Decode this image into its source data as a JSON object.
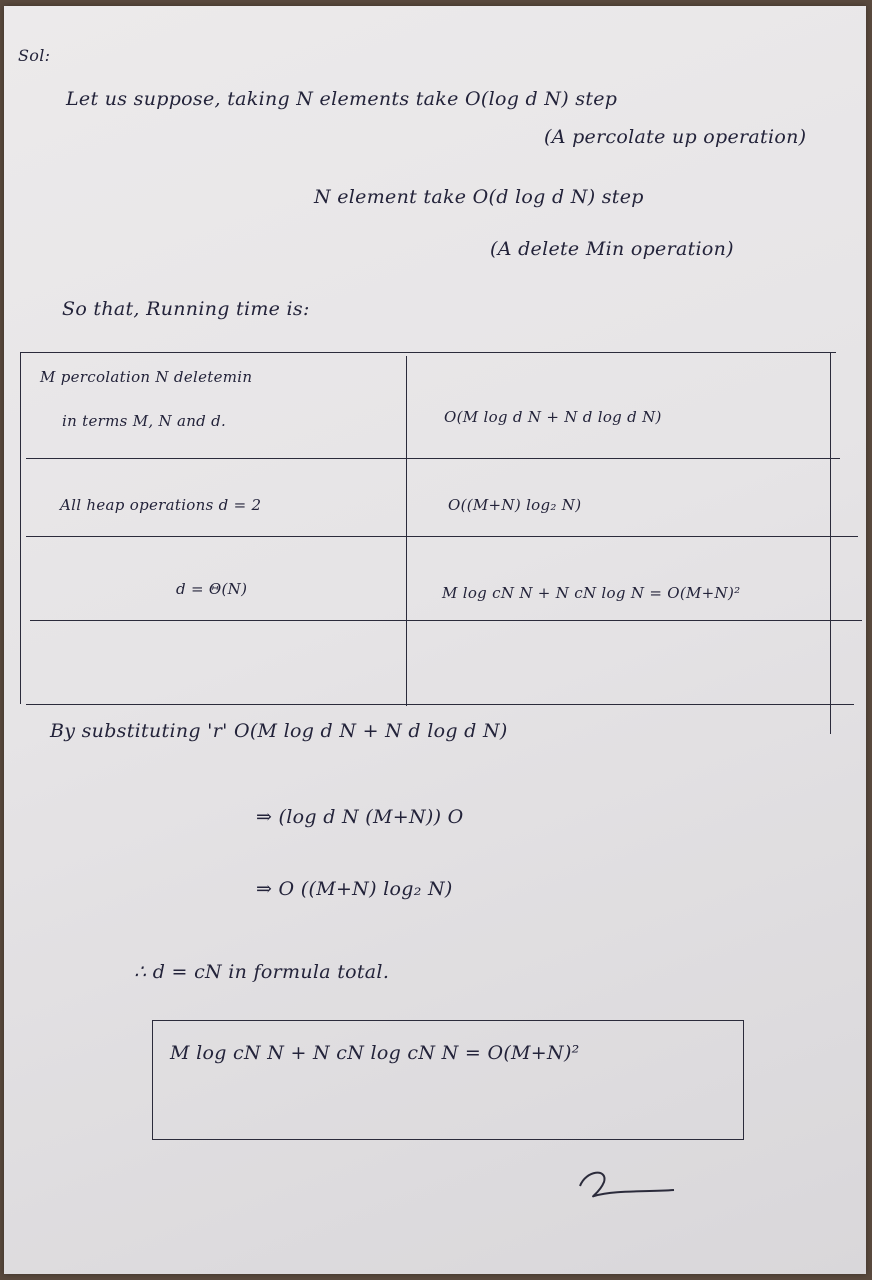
{
  "header": {
    "label": "Sol:"
  },
  "intro": {
    "line1": "Let us suppose, taking N elements take O(log d N) step",
    "line2": "(A percolate up operation)",
    "line3": "N element take O(d log d N) step",
    "line4": "(A delete Min operation)",
    "line5": "So that, Running time is:"
  },
  "table": {
    "rows": [
      {
        "left": [
          "M percolation N deletemin",
          "in terms M, N and d."
        ],
        "right": "O(M log d N + N d log d N)"
      },
      {
        "left": [
          "All heap operations d = 2"
        ],
        "right": "O((M+N) log₂ N)"
      },
      {
        "left": [
          "d = Θ(N)"
        ],
        "right": "M log cN N + N cN log N = O(M+N)²"
      },
      {
        "left": [
          ""
        ],
        "right": ""
      }
    ]
  },
  "derivation": {
    "line1": "By substituting 'r' O(M log d N + N d log d N)",
    "line2": "⇒ (log d N (M+N)) O",
    "line3": "⇒ O ((M+N) log₂ N)",
    "line4": "∴ d = cN in formula total.",
    "boxed": "M log cN N + N cN log cN N = O(M+N)²"
  }
}
